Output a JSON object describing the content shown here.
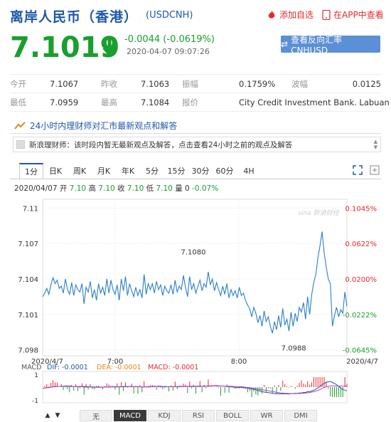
{
  "header": {
    "title": "离岸人民币（香港）",
    "code": "(USDCNH)",
    "add_watch": "添加自选",
    "open_app": "在APP中查看"
  },
  "quote": {
    "price": "7.1019",
    "change": "-0.0044 (-0.0619%)",
    "timestamp": "2020-04-07 09:07:26",
    "reverse_button": "查看反向汇率 CNHUSD"
  },
  "stats": {
    "rows": [
      [
        {
          "label": "今开",
          "value": "7.1067"
        },
        {
          "label": "昨收",
          "value": "7.1063"
        },
        {
          "label": "振幅",
          "value": "0.1759%"
        },
        {
          "label": "波幅",
          "value": "0.0125"
        }
      ],
      [
        {
          "label": "最低",
          "value": "7.0959"
        },
        {
          "label": "最高",
          "value": "7.1084"
        },
        {
          "label": "报价",
          "value": "City Credit Investment Bank. Labuan"
        }
      ]
    ]
  },
  "blurb": "24小时内理财师对汇市最新观点和解答",
  "message": "新浪理财师：该时段内暂无最新观点及解答，点击查看24小时之前的观点及解答",
  "tabs": [
    "1分",
    "日K",
    "周K",
    "月K",
    "年K",
    "5分",
    "15分",
    "30分",
    "60分",
    "4H"
  ],
  "quote_line": {
    "date": "2020/04/07",
    "open_label": "开",
    "open": "7.10",
    "high_label": "高",
    "high": "7.10",
    "close_label": "收",
    "close": "7.10",
    "low_label": "低",
    "low": "7.10",
    "vol_label": "量",
    "vol": "0",
    "pct": "-0.07%"
  },
  "chart_data": {
    "type": "line",
    "y_ticks": [
      "7.11",
      "7.107",
      "7.104",
      "7.101",
      "7.098"
    ],
    "pct_ticks": [
      "0.1045%",
      "0.0622%",
      "0.0200%",
      "-0.0222%",
      "-0.0645%"
    ],
    "x_labels": [
      "2020/4/7",
      "7:00",
      "8:00",
      "2020/4/7"
    ],
    "ylim": [
      7.0975,
      7.1105
    ],
    "high_annotation": "7.1080",
    "low_annotation": "7.0988",
    "watermark": "sina 新浪财经",
    "series": [
      {
        "values": [
          7.1025,
          7.1028,
          7.1032,
          7.1027,
          7.1035,
          7.1041,
          7.1036,
          7.1039,
          7.1032,
          7.1034,
          7.1028,
          7.104,
          7.1031,
          7.1027,
          7.1037,
          7.1026,
          7.1035,
          7.1031,
          7.1029,
          7.1036,
          7.1019,
          7.1033,
          7.1029,
          7.1038,
          7.1024,
          7.1031,
          7.1022,
          7.1036,
          7.1028,
          7.1033,
          7.1026,
          7.104,
          7.1028,
          7.1039,
          7.1031,
          7.1027,
          7.1035,
          7.1022,
          7.104,
          7.103,
          7.1042,
          7.1026,
          7.1036,
          7.103,
          7.1025,
          7.1033,
          7.1026,
          7.1031,
          7.1024,
          7.1044,
          7.1027,
          7.1036,
          7.1031,
          7.1036,
          7.1028,
          7.1038,
          7.1031,
          7.1035,
          7.1026,
          7.1034,
          7.103,
          7.1028,
          7.1035,
          7.1027,
          7.1039,
          7.1029,
          7.1034,
          7.1031,
          7.1043,
          7.1033,
          7.1025,
          7.1042,
          7.1031,
          7.1036,
          7.1028,
          7.1034,
          7.1039,
          7.103,
          7.1036,
          7.1033,
          7.1046,
          7.1035,
          7.104,
          7.103,
          7.1037,
          7.1031,
          7.1026,
          7.1034,
          7.1027,
          7.1036,
          7.1024,
          7.1031,
          7.1026,
          7.103,
          7.1024,
          7.1033,
          7.1026,
          7.1028,
          7.1022,
          7.1018,
          7.1015,
          7.1008,
          7.1016,
          7.1011,
          7.1003,
          7.1009,
          7.1,
          7.1013,
          7.1004,
          7.1008,
          7.1,
          7.0994,
          7.1004,
          7.0997,
          7.1009,
          7.0999,
          7.1015,
          7.1001,
          7.1006,
          7.0996,
          7.1012,
          7.1,
          7.1011,
          7.1004,
          7.1016,
          7.1012,
          7.102,
          7.1006,
          7.1025,
          7.101,
          7.1027,
          7.1037,
          7.1044,
          7.1058,
          7.1068,
          7.108,
          7.1062,
          7.105,
          7.104,
          7.1036,
          7.1,
          7.1009,
          7.1016,
          7.1008,
          7.1014,
          7.1011,
          7.1029,
          7.1017
        ]
      }
    ]
  },
  "macd": {
    "label": "MACD",
    "dif": "DIF: -0.0001",
    "dea": "DEA: -0.0001",
    "macd": "MACD: -0.0001",
    "ticks": [
      "1",
      "-1"
    ]
  },
  "indicator_tabs": [
    "无",
    "MACD",
    "KDJ",
    "RSI",
    "BOLL",
    "WR",
    "DMI"
  ],
  "colors": {
    "brand": "#1e58a8",
    "up": "#e52a2a",
    "down": "#1a9e2e",
    "line": "#2a7fc9"
  }
}
